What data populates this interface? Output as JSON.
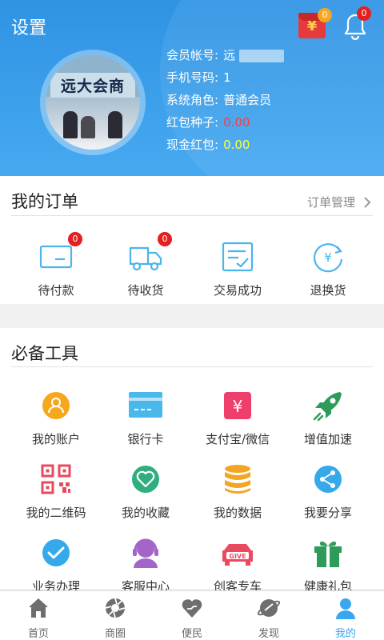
{
  "header": {
    "title": "设置",
    "redpacket_badge": "0",
    "bell_badge": "0",
    "avatar_text": "远大会商"
  },
  "profile": {
    "member_account_label": "会员帐号:",
    "member_account_value": "远",
    "phone_label": "手机号码:",
    "phone_value": "1",
    "role_label": "系统角色:",
    "role_value": "普通会员",
    "seed_label": "红包种子:",
    "seed_value": "0.00",
    "cash_label": "现金红包:",
    "cash_value": "0.00"
  },
  "orders": {
    "title": "我的订单",
    "manage_label": "订单管理",
    "items": [
      {
        "label": "待付款",
        "badge": "0"
      },
      {
        "label": "待收货",
        "badge": "0"
      },
      {
        "label": "交易成功"
      },
      {
        "label": "退换货"
      }
    ]
  },
  "tools": {
    "title": "必备工具",
    "items": [
      {
        "label": "我的账户"
      },
      {
        "label": "银行卡"
      },
      {
        "label": "支付宝/微信"
      },
      {
        "label": "增值加速"
      },
      {
        "label": "我的二维码"
      },
      {
        "label": "我的收藏"
      },
      {
        "label": "我的数据"
      },
      {
        "label": "我要分享"
      },
      {
        "label": "业务办理"
      },
      {
        "label": "客服中心"
      },
      {
        "label": "创客专车",
        "icon_text": "GIVE"
      },
      {
        "label": "健康礼包"
      }
    ]
  },
  "nav": {
    "items": [
      {
        "label": "首页"
      },
      {
        "label": "商圈"
      },
      {
        "label": "便民"
      },
      {
        "label": "发现"
      },
      {
        "label": "我的"
      }
    ]
  },
  "colors": {
    "header_blue": "#3a9ded",
    "accent_blue": "#3aa6ef",
    "red": "#e41f1f"
  }
}
